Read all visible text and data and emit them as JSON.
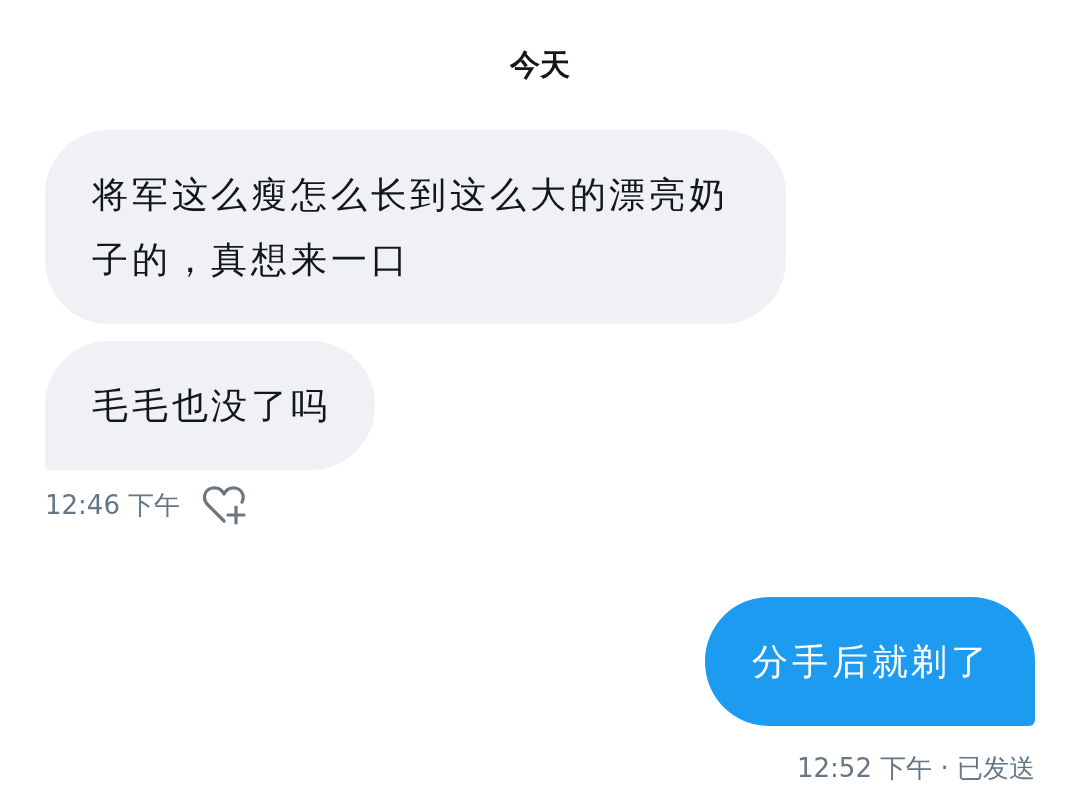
{
  "date_divider": "今天",
  "incoming": {
    "messages": [
      {
        "text": "将军这么瘦怎么长到这么大的漂亮奶子的，真想来一口"
      },
      {
        "text": "毛毛也没了吗"
      }
    ],
    "time": "12:46 下午"
  },
  "outgoing": {
    "messages": [
      {
        "text": "分手后就剃了"
      }
    ],
    "status": "12:52 下午 · 已发送"
  }
}
